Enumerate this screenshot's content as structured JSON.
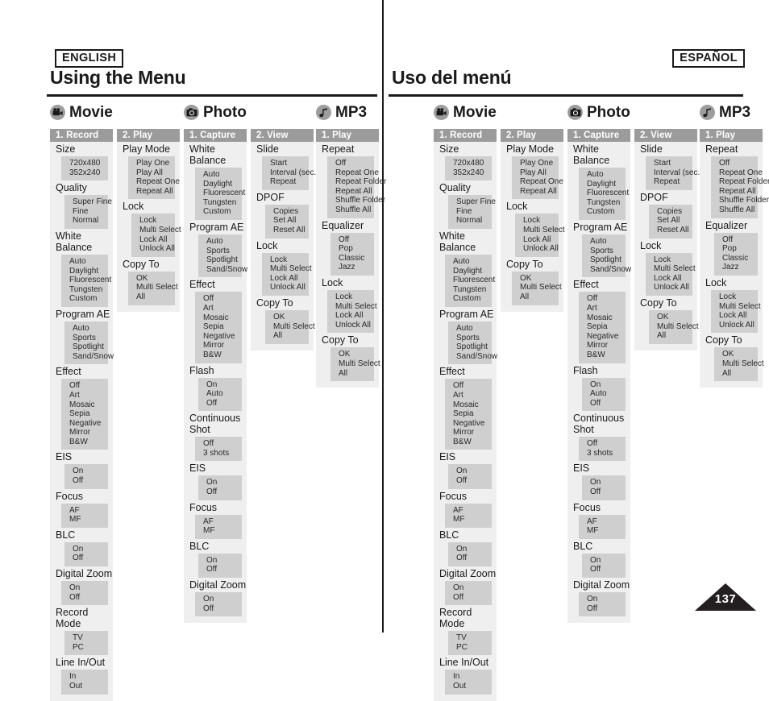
{
  "page": {
    "number": "137"
  },
  "panes": [
    {
      "id": "english",
      "lang_badge": "ENGLISH",
      "title": "Using the Menu"
    },
    {
      "id": "espanol",
      "lang_badge": "ESPAÑOL",
      "title": "Uso del menú"
    }
  ],
  "categories": [
    {
      "icon": "movie-camera-icon",
      "label": "Movie"
    },
    {
      "icon": "camera-icon",
      "label": "Photo"
    },
    {
      "icon": "music-note-icon",
      "label": "MP3"
    }
  ],
  "columns": [
    {
      "header": "1. Record",
      "groups": [
        {
          "title": "Size",
          "options": [
            "720x480",
            "352x240"
          ]
        },
        {
          "title": "Quality",
          "options": [
            "Super Fine",
            "Fine",
            "Normal"
          ]
        },
        {
          "title": "White Balance",
          "options": [
            "Auto",
            "Daylight",
            "Fluorescent",
            "Tungsten",
            "Custom"
          ]
        },
        {
          "title": "Program AE",
          "options": [
            "Auto",
            "Sports",
            "Spotlight",
            "Sand/Snow"
          ]
        },
        {
          "title": "Effect",
          "options": [
            "Off",
            "Art",
            "Mosaic",
            "Sepia",
            "Negative",
            "Mirror",
            "B&W"
          ]
        },
        {
          "title": "EIS",
          "options": [
            "On",
            "Off"
          ]
        },
        {
          "title": "Focus",
          "options": [
            "AF",
            "MF"
          ]
        },
        {
          "title": "BLC",
          "options": [
            "On",
            "Off"
          ]
        },
        {
          "title": "Digital Zoom",
          "options": [
            "On",
            "Off"
          ]
        },
        {
          "title": "Record Mode",
          "options": [
            "TV",
            "PC"
          ]
        },
        {
          "title": "Line In/Out",
          "options": [
            "In",
            "Out"
          ]
        }
      ]
    },
    {
      "header": "2. Play",
      "groups": [
        {
          "title": "Play Mode",
          "options": [
            "Play One",
            "Play All",
            "Repeat One",
            "Repeat All"
          ]
        },
        {
          "title": "Lock",
          "options": [
            "Lock",
            "Multi Select",
            "Lock All",
            "Unlock All"
          ]
        },
        {
          "title": "Copy To",
          "options": [
            "OK",
            "Multi Select",
            "All"
          ]
        }
      ]
    },
    {
      "header": "1. Capture",
      "groups": [
        {
          "title": "White Balance",
          "options": [
            "Auto",
            "Daylight",
            "Fluorescent",
            "Tungsten",
            "Custom"
          ]
        },
        {
          "title": "Program AE",
          "options": [
            "Auto",
            "Sports",
            "Spotlight",
            "Sand/Snow"
          ]
        },
        {
          "title": "Effect",
          "options": [
            "Off",
            "Art",
            "Mosaic",
            "Sepia",
            "Negative",
            "Mirror",
            "B&W"
          ]
        },
        {
          "title": "Flash",
          "options": [
            "On",
            "Auto",
            "Off"
          ]
        },
        {
          "title": "Continuous Shot",
          "options": [
            "Off",
            "3 shots"
          ]
        },
        {
          "title": "EIS",
          "options": [
            "On",
            "Off"
          ]
        },
        {
          "title": "Focus",
          "options": [
            "AF",
            "MF"
          ]
        },
        {
          "title": "BLC",
          "options": [
            "On",
            "Off"
          ]
        },
        {
          "title": "Digital Zoom",
          "options": [
            "On",
            "Off"
          ]
        }
      ]
    },
    {
      "header": "2. View",
      "groups": [
        {
          "title": "Slide",
          "options": [
            "Start",
            "Interval (sec.)",
            "Repeat"
          ]
        },
        {
          "title": "DPOF",
          "options": [
            "Copies",
            "Set All",
            "Reset All"
          ]
        },
        {
          "title": "Lock",
          "options": [
            "Lock",
            "Multi Select",
            "Lock All",
            "Unlock All"
          ]
        },
        {
          "title": "Copy To",
          "options": [
            "OK",
            "Multi Select",
            "All"
          ]
        }
      ]
    },
    {
      "header": "1. Play",
      "groups": [
        {
          "title": "Repeat",
          "options": [
            "Off",
            "Repeat One",
            "Repeat Folder",
            "Repeat All",
            "Shuffle Folder",
            "Shuffle All"
          ]
        },
        {
          "title": "Equalizer",
          "options": [
            "Off",
            "Pop",
            "Classic",
            "Jazz"
          ]
        },
        {
          "title": "Lock",
          "options": [
            "Lock",
            "Multi Select",
            "Lock All",
            "Unlock All"
          ]
        },
        {
          "title": "Copy To",
          "options": [
            "OK",
            "Multi Select",
            "All"
          ]
        }
      ]
    }
  ],
  "colors": {
    "header_bar": "#9b9b9b",
    "column_bg": "#efefef",
    "option_bg": "#cfcfcf",
    "rule": "#1a1a1a",
    "page_badge": "#231f20"
  }
}
